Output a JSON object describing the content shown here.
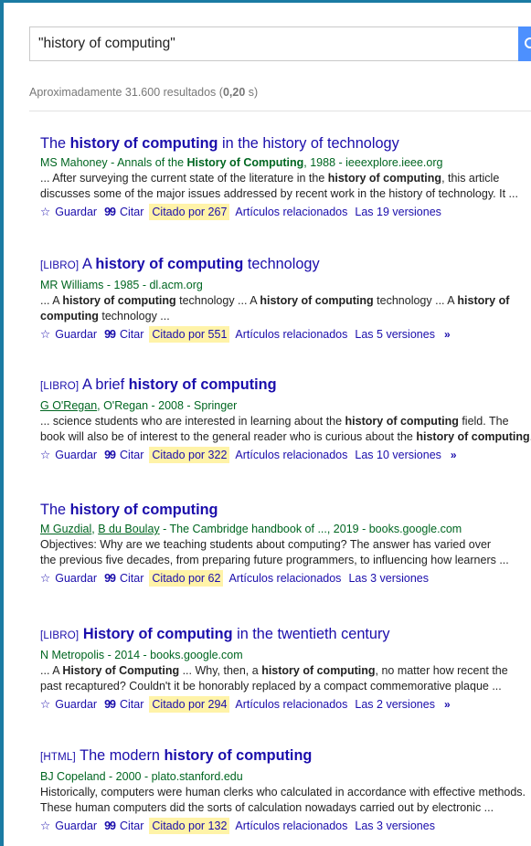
{
  "search": {
    "query": "\"history of computing\""
  },
  "results_count": {
    "prefix": "Aproximadamente 31.600 resultados (",
    "time": "0,20",
    "suffix": " s)"
  },
  "actions": {
    "save": "Guardar",
    "cite": "Citar",
    "related": "Artículos relacionados"
  },
  "results": [
    {
      "tag": "",
      "title": [
        [
          "The ",
          false
        ],
        [
          "history of computing",
          true
        ],
        [
          " in the history of technology",
          false
        ]
      ],
      "meta": [
        [
          "MS Mahoney - Annals of the ",
          false,
          false
        ],
        [
          "History of Computing",
          true,
          false
        ],
        [
          ", 1988 - ieeexplore.ieee.org",
          false,
          false
        ]
      ],
      "snippet": [
        [
          [
            "... After surveying the current state of the literature in the ",
            false
          ],
          [
            "history of computing",
            true
          ],
          [
            ", this article",
            false
          ]
        ],
        [
          [
            "discusses some of the major issues addressed by recent work in the history of technology. It ...",
            false
          ]
        ]
      ],
      "cited": "Citado por 267",
      "versions": "Las 19 versiones",
      "more": false
    },
    {
      "tag": "[LIBRO]",
      "title": [
        [
          "A ",
          false
        ],
        [
          "history of computing",
          true
        ],
        [
          " technology",
          false
        ]
      ],
      "meta": [
        [
          "MR Williams - 1985 - dl.acm.org",
          false,
          false
        ]
      ],
      "snippet": [
        [
          [
            "... A ",
            false
          ],
          [
            "history of computing",
            true
          ],
          [
            " technology ... A ",
            false
          ],
          [
            "history of computing",
            true
          ],
          [
            " technology ... A ",
            false
          ],
          [
            "history of",
            true
          ]
        ],
        [
          [
            "computing",
            true
          ],
          [
            " technology ...",
            false
          ]
        ]
      ],
      "cited": "Citado por 551",
      "versions": "Las 5 versiones",
      "more": true
    },
    {
      "tag": "[LIBRO]",
      "title": [
        [
          "A brief ",
          false
        ],
        [
          "history of computing",
          true
        ]
      ],
      "meta": [
        [
          "G O'Regan",
          false,
          true
        ],
        [
          ", O'Regan - 2008 - Springer",
          false,
          false
        ]
      ],
      "snippet": [
        [
          [
            "... science students who are interested in learning about the ",
            false
          ],
          [
            "history of computing",
            true
          ],
          [
            " field. The",
            false
          ]
        ],
        [
          [
            "book will also be of interest to the general reader who is curious about the ",
            false
          ],
          [
            "history of computing",
            true
          ],
          [
            ". ...",
            false
          ]
        ]
      ],
      "cited": "Citado por 322",
      "versions": "Las 10 versiones",
      "more": true
    },
    {
      "tag": "",
      "title": [
        [
          "The ",
          false
        ],
        [
          "history of computing",
          true
        ]
      ],
      "meta": [
        [
          "M Guzdial",
          false,
          true
        ],
        [
          ", ",
          false,
          false
        ],
        [
          "B du Boulay",
          false,
          true
        ],
        [
          " - The Cambridge handbook of ..., 2019 - books.google.com",
          false,
          false
        ]
      ],
      "snippet": [
        [
          [
            "Objectives: Why are we teaching students about computing? The answer has varied over",
            false
          ]
        ],
        [
          [
            "the previous five decades, from preparing future programmers, to influencing how learners ...",
            false
          ]
        ]
      ],
      "cited": "Citado por 62",
      "versions": "Las 3 versiones",
      "more": false
    },
    {
      "tag": "[LIBRO]",
      "title": [
        [
          "History of computing",
          true
        ],
        [
          " in the twentieth century",
          false
        ]
      ],
      "meta": [
        [
          "N Metropolis - 2014 - books.google.com",
          false,
          false
        ]
      ],
      "snippet": [
        [
          [
            "... A ",
            false
          ],
          [
            "History of Computing",
            true
          ],
          [
            " ... Why, then, a ",
            false
          ],
          [
            "history of computing",
            true
          ],
          [
            ", no matter how recent the",
            false
          ]
        ],
        [
          [
            "past recaptured? Couldn't it be honorably replaced by a compact commemorative plaque ...",
            false
          ]
        ]
      ],
      "cited": "Citado por 294",
      "versions": "Las 2 versiones",
      "more": true
    },
    {
      "tag": "[HTML]",
      "title": [
        [
          "The modern ",
          false
        ],
        [
          "history of computing",
          true
        ]
      ],
      "meta": [
        [
          "BJ Copeland - 2000 - plato.stanford.edu",
          false,
          false
        ]
      ],
      "snippet": [
        [
          [
            "Historically, computers were human clerks who calculated in accordance with effective methods.",
            false
          ]
        ],
        [
          [
            "These human computers did the sorts of calculation nowadays carried out by electronic ...",
            false
          ]
        ]
      ],
      "cited": "Citado por 132",
      "versions": "Las 3 versiones",
      "more": false
    }
  ]
}
